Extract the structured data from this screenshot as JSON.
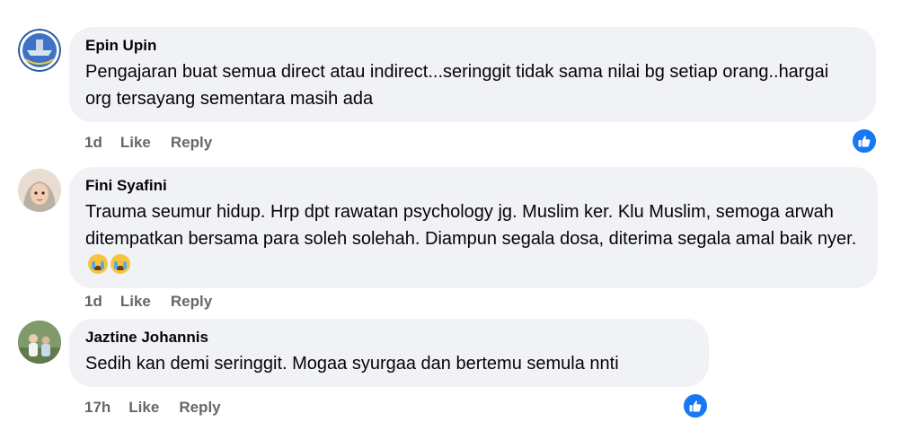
{
  "comments": [
    {
      "author": "Epin Upin",
      "text": "Pengajaran buat semua direct atau indirect...seringgit tidak sama nilai bg setiap orang..hargai org tersayang sementara masih ada",
      "time": "1d",
      "like_label": "Like",
      "reply_label": "Reply",
      "reaction_icon": "thumbs-up-icon"
    },
    {
      "author": "Fini Syafini",
      "text": "Trauma seumur hidup. Hrp dpt rawatan psychology jg. Muslim ker. Klu Muslim, semoga arwah ditempatkan bersama para soleh solehah. Diampun segala dosa, diterima segala amal baik nyer.",
      "emoji": [
        "crying-face-emoji",
        "crying-face-emoji"
      ],
      "time": "1d",
      "like_label": "Like",
      "reply_label": "Reply"
    },
    {
      "author": "Jaztine Johannis",
      "text": "Sedih kan demi seringgit. Mogaa syurgaa dan bertemu semula nnti",
      "time": "17h",
      "like_label": "Like",
      "reply_label": "Reply",
      "reaction_icon": "thumbs-up-icon"
    }
  ],
  "colors": {
    "bubble": "#f0f2f5",
    "meta_text": "#65676b",
    "like_blue": "#1877f2"
  }
}
